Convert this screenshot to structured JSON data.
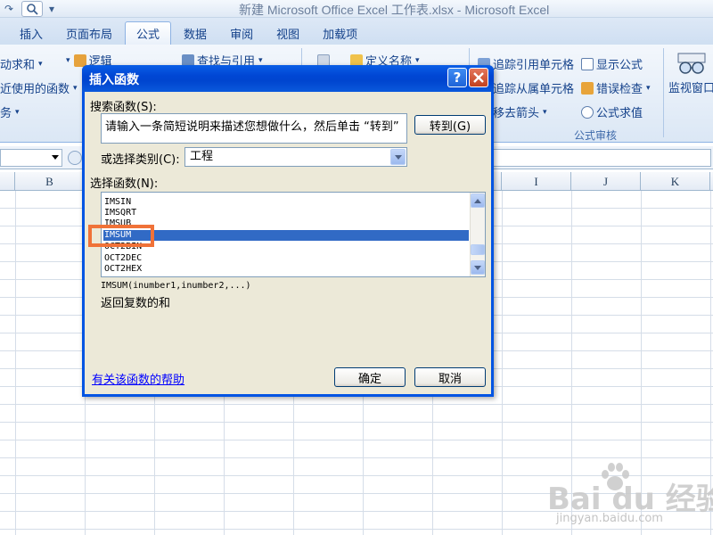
{
  "window": {
    "title": "新建 Microsoft Office Excel 工作表.xlsx - Microsoft Excel"
  },
  "tabs": [
    "插入",
    "页面布局",
    "公式",
    "数据",
    "审阅",
    "视图",
    "加载项"
  ],
  "active_tab": "公式",
  "ribbon": {
    "autosum": "动求和",
    "recent": "近使用的函数",
    "finance": "务",
    "logical": "逻辑",
    "lookup": "查找与引用",
    "define_name": "定义名称",
    "trace_precedents": "追踪引用单元格",
    "show_formulas": "显示公式",
    "trace_dependents": "追踪从属单元格",
    "error_checking": "错误检查",
    "remove_arrows": "移去箭头",
    "evaluate_formula": "公式求值",
    "watch_window": "监视窗口",
    "group_label": "公式审核"
  },
  "columns": [
    "B",
    "I",
    "J",
    "K"
  ],
  "dialog": {
    "title": "插入函数",
    "help_button": "?",
    "search_label": "搜索函数(S):",
    "search_value": "请输入一条简短说明来描述您想做什么，然后单击 “转到”",
    "goto_button": "转到(G)",
    "category_label": "或选择类别(C):",
    "category_value": "工程",
    "function_label": "选择函数(N):",
    "functions": [
      "IMSIN",
      "IMSQRT",
      "IMSUB",
      "IMSUM",
      "OCT2BIN",
      "OCT2DEC",
      "OCT2HEX"
    ],
    "selected_function": "IMSUM",
    "syntax": "IMSUM(inumber1,inumber2,...)",
    "description": "返回复数的和",
    "help_link": "有关该函数的帮助",
    "ok_button": "确定",
    "cancel_button": "取消"
  },
  "watermark": {
    "main": "Bai du 经验",
    "sub": "jingyan.baidu.com"
  }
}
